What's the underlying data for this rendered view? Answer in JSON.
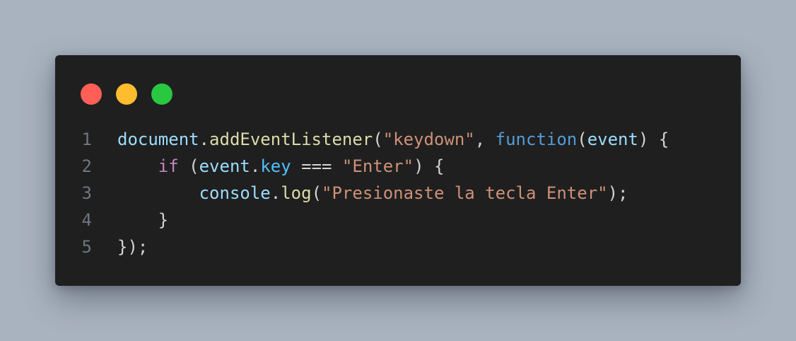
{
  "colors": {
    "background": "#a9b3bf",
    "window": "#1f1f1f",
    "close_dot": "#ff5f57",
    "minimize_dot": "#febc2e",
    "maximize_dot": "#28c840",
    "line_number": "#6e7681",
    "default_text": "#d4d4d4",
    "variable": "#9cdcfe",
    "function_call": "#dcdcaa",
    "string": "#ce9178",
    "keyword_storage": "#569cd6",
    "keyword_control": "#c586c0",
    "property": "#4fc1ff"
  },
  "window_controls": {
    "close_icon": "red-circle",
    "minimize_icon": "yellow-circle",
    "maximize_icon": "green-circle"
  },
  "code_lines": [
    {
      "number": "1",
      "tokens": [
        {
          "text": "document",
          "type": "variable"
        },
        {
          "text": ".",
          "type": "default_text"
        },
        {
          "text": "addEventListener",
          "type": "function_call"
        },
        {
          "text": "(",
          "type": "default_text"
        },
        {
          "text": "\"keydown\"",
          "type": "string"
        },
        {
          "text": ", ",
          "type": "default_text"
        },
        {
          "text": "function",
          "type": "keyword_storage"
        },
        {
          "text": "(",
          "type": "default_text"
        },
        {
          "text": "event",
          "type": "variable"
        },
        {
          "text": ") {",
          "type": "default_text"
        }
      ]
    },
    {
      "number": "2",
      "tokens": [
        {
          "text": "    ",
          "type": "default_text"
        },
        {
          "text": "if",
          "type": "keyword_control"
        },
        {
          "text": " (",
          "type": "default_text"
        },
        {
          "text": "event",
          "type": "variable"
        },
        {
          "text": ".",
          "type": "default_text"
        },
        {
          "text": "key",
          "type": "property"
        },
        {
          "text": " === ",
          "type": "default_text"
        },
        {
          "text": "\"Enter\"",
          "type": "string"
        },
        {
          "text": ") {",
          "type": "default_text"
        }
      ]
    },
    {
      "number": "3",
      "tokens": [
        {
          "text": "        ",
          "type": "default_text"
        },
        {
          "text": "console",
          "type": "variable"
        },
        {
          "text": ".",
          "type": "default_text"
        },
        {
          "text": "log",
          "type": "function_call"
        },
        {
          "text": "(",
          "type": "default_text"
        },
        {
          "text": "\"Presionaste la tecla Enter\"",
          "type": "string"
        },
        {
          "text": ");",
          "type": "default_text"
        }
      ]
    },
    {
      "number": "4",
      "tokens": [
        {
          "text": "    }",
          "type": "default_text"
        }
      ]
    },
    {
      "number": "5",
      "tokens": [
        {
          "text": "});",
          "type": "default_text"
        }
      ]
    }
  ]
}
